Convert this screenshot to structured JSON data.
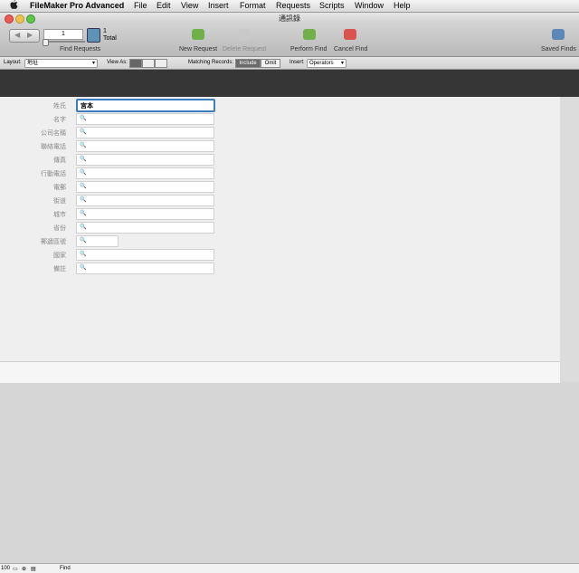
{
  "menubar": {
    "app_name": "FileMaker Pro Advanced",
    "items": [
      "File",
      "Edit",
      "View",
      "Insert",
      "Format",
      "Requests",
      "Scripts",
      "Window",
      "Help"
    ]
  },
  "window": {
    "title": "通訊錄"
  },
  "toolbar": {
    "record_number": "1",
    "total_count": "1",
    "total_label": "Total",
    "find_requests_label": "Find Requests",
    "new_request_label": "New Request",
    "delete_request_label": "Delete Request",
    "perform_find_label": "Perform Find",
    "cancel_find_label": "Cancel Find",
    "saved_finds_label": "Saved Finds"
  },
  "layoutbar": {
    "layout_label": "Layout:",
    "layout_value": "地址",
    "view_as_label": "View As:",
    "matching_records_label": "Matching Records:",
    "include_label": "Include",
    "omit_label": "Omit",
    "insert_label": "Insert:",
    "operators_label": "Operators"
  },
  "form": {
    "fields": [
      {
        "label": "姓氏",
        "value": "宮本",
        "active": true
      },
      {
        "label": "名字",
        "value": ""
      },
      {
        "label": "公司名稱",
        "value": ""
      },
      {
        "label": "聯絡電話",
        "value": ""
      },
      {
        "label": "傳真",
        "value": ""
      },
      {
        "label": "行動電話",
        "value": ""
      },
      {
        "label": "電郵",
        "value": ""
      },
      {
        "label": "街道",
        "value": ""
      },
      {
        "label": "城市",
        "value": ""
      },
      {
        "label": "省份",
        "value": ""
      },
      {
        "label": "郵遞區號",
        "value": ""
      },
      {
        "label": "國家",
        "value": ""
      },
      {
        "label": "備註",
        "value": ""
      }
    ]
  },
  "status": {
    "zoom": "100",
    "mode": "Find"
  },
  "colors": {
    "header_band": "#363636",
    "active_field_border": "#3d7cbf",
    "close": "#ec5a52",
    "minimize": "#f1c14b",
    "zoom": "#5ec749"
  }
}
